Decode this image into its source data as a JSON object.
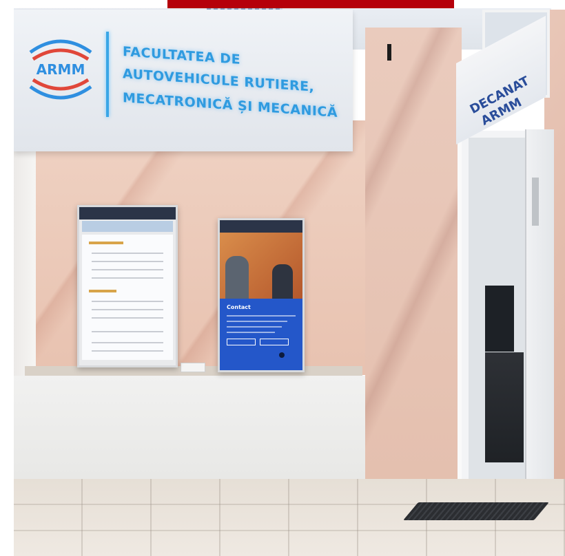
{
  "sign": {
    "logo_text": "ARMM",
    "lines": [
      "FACULTATEA DE",
      "AUTOVEHICULE RUTIERE,",
      "MECATRONICĂ ȘI MECANICĂ"
    ]
  },
  "door_sign": {
    "lines": [
      "DECANAT",
      "ARMM"
    ]
  },
  "screens": {
    "right": {
      "section_title": "Contact"
    }
  },
  "colors": {
    "sign_text": "#2f9be0",
    "logo_blue": "#2f8fe0",
    "logo_red": "#e0473a",
    "decanat_text": "#2a4d9a",
    "top_bar": "#b5000b",
    "screen_blue": "#2457c9"
  }
}
